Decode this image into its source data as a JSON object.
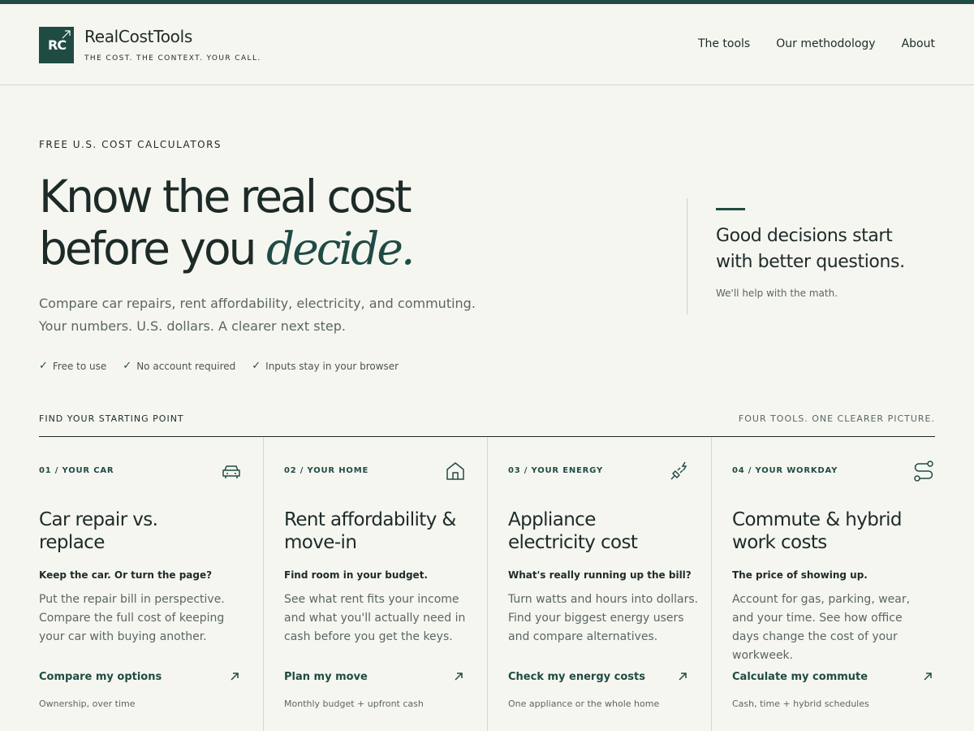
{
  "header": {
    "logo_mark": "RC",
    "brand_name": "RealCostTools",
    "tagline": "THE COST. THE CONTEXT. YOUR CALL.",
    "nav": [
      "The tools",
      "Our methodology",
      "About"
    ]
  },
  "hero": {
    "eyebrow": "FREE U.S. COST CALCULATORS",
    "headline_line1": "Know the real cost",
    "headline_line2_plain": "before you ",
    "headline_line2_em": "decide.",
    "sub_line1": "Compare car repairs, rent affordability, electricity, and commuting.",
    "sub_line2": "Your numbers. U.S. dollars. A clearer next step.",
    "checks": [
      "Free to use",
      "No account required",
      "Inputs stay in your browser"
    ],
    "check_glyph": "✓"
  },
  "aside": {
    "quote_line1": "Good decisions start",
    "quote_line2": "with better questions.",
    "note": "We'll help with the math."
  },
  "tools_section": {
    "label": "FIND YOUR STARTING POINT",
    "right_label": "FOUR TOOLS. ONE CLEARER PICTURE.",
    "cards": [
      {
        "num": "01 / YOUR CAR",
        "icon": "car-icon",
        "title_line1": "Car repair vs.",
        "title_line2": "replace",
        "lead": "Keep the car. Or turn the page?",
        "desc": "Put the repair bill in perspective. Compare the full cost of keeping your car with buying another.",
        "cta": "Compare my options",
        "foot": "Ownership, over time"
      },
      {
        "num": "02 / YOUR HOME",
        "icon": "home-icon",
        "title_line1": "Rent affordability &",
        "title_line2": "move-in",
        "lead": "Find room in your budget.",
        "desc": "See what rent fits your income and what you'll actually need in cash before you get the keys.",
        "cta": "Plan my move",
        "foot": "Monthly budget + upfront cash"
      },
      {
        "num": "03 / YOUR ENERGY",
        "icon": "plug-icon",
        "title_line1": "Appliance",
        "title_line2": "electricity cost",
        "lead": "What's really running up the bill?",
        "desc": "Turn watts and hours into dollars. Find your biggest energy users and compare alternatives.",
        "cta": "Check my energy costs",
        "foot": "One appliance or the whole home"
      },
      {
        "num": "04 / YOUR WORKDAY",
        "icon": "route-icon",
        "title_line1": "Commute & hybrid",
        "title_line2": "work costs",
        "lead": "The price of showing up.",
        "desc": "Account for gas, parking, wear, and your time. See how office days change the cost of your workweek.",
        "cta": "Calculate my commute",
        "foot": "Cash, time + hybrid schedules"
      }
    ]
  },
  "colors": {
    "accent": "#1f4b43",
    "background": "#f6f6f1",
    "text": "#1d2b28",
    "muted": "#5a6663"
  }
}
